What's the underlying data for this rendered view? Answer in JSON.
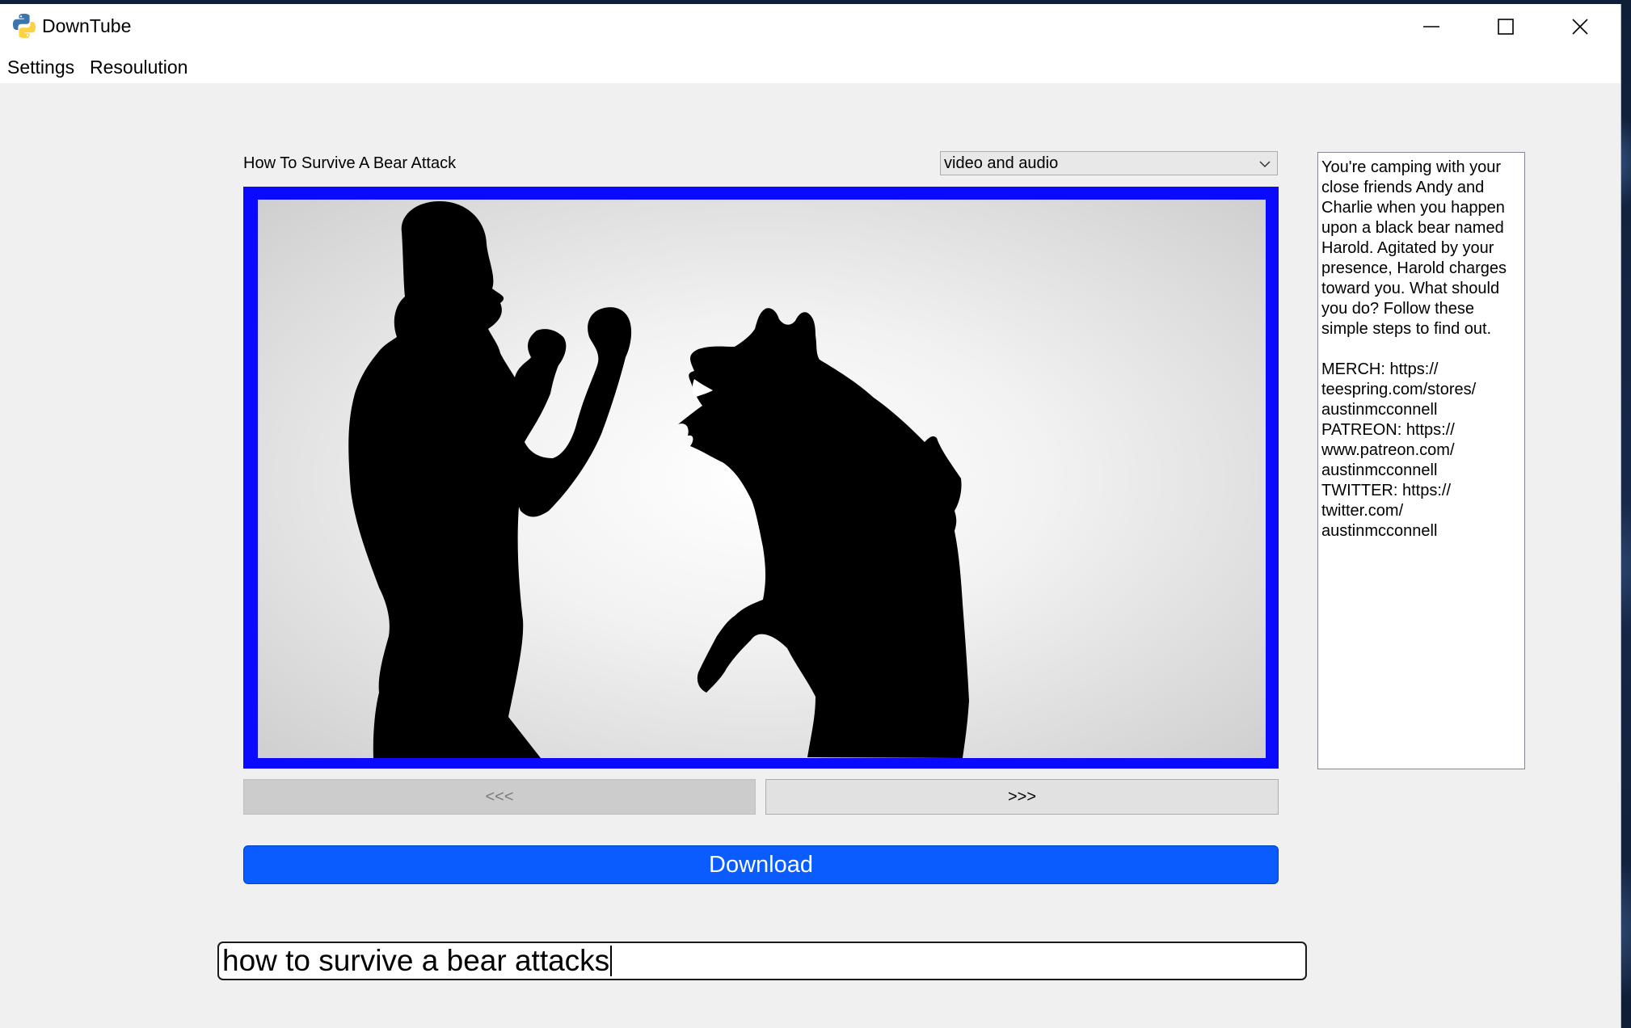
{
  "window": {
    "title": "DownTube",
    "icon": "python-logo-icon",
    "controls": [
      "minimize-icon",
      "maximize-icon",
      "close-icon"
    ]
  },
  "menu": {
    "items": [
      {
        "label": "Settings"
      },
      {
        "label": "Resoulution"
      }
    ]
  },
  "video": {
    "title": "How To Survive A Bear Attack",
    "format_selected": "video and audio",
    "thumbnail": "person-facing-bear-silhouette",
    "description": "You're camping with your close friends Andy and Charlie when you happen upon a black bear named Harold. Agitated by your presence, Harold charges toward you. What should you do? Follow these simple steps to find out.\n\nMERCH: https://\nteespring.com/stores/\naustinmcconnell\nPATREON: https://\nwww.patreon.com/\naustinmcconnell\nTWITTER: https://\ntwitter.com/\naustinmcconnell"
  },
  "navigation": {
    "prev_label": "<<<",
    "next_label": ">>>"
  },
  "download": {
    "label": "Download"
  },
  "search": {
    "value": "how to survive a bear attacks"
  },
  "colors": {
    "thumbnail_border": "#0a0aff",
    "download_button": "#0a5cff",
    "window_background": "#f0f0f0"
  }
}
